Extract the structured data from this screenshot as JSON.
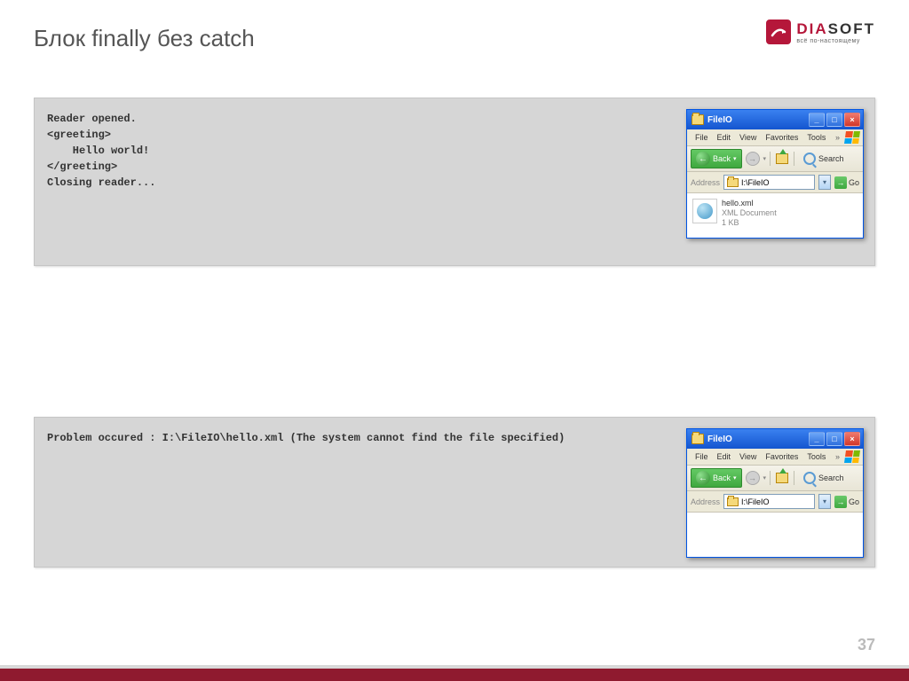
{
  "slide": {
    "title": "Блок finally без catch",
    "pageNumber": "37"
  },
  "logo": {
    "brand_dia": "DIA",
    "brand_soft": "SOFT",
    "tagline": "всё по-настоящему"
  },
  "panel1": {
    "code": "Reader opened.\n<greeting>\n    Hello world!\n</greeting>\nClosing reader..."
  },
  "panel2": {
    "code": "Problem occured : I:\\FileIO\\hello.xml (The system cannot find the file specified)"
  },
  "explorer1": {
    "title": "FileIO",
    "menu": {
      "file": "File",
      "edit": "Edit",
      "view": "View",
      "favorites": "Favorites",
      "tools": "Tools"
    },
    "toolbar": {
      "back": "Back",
      "search": "Search"
    },
    "address": {
      "label": "Address",
      "path": "I:\\FileIO",
      "go": "Go"
    },
    "file": {
      "name": "hello.xml",
      "type": "XML Document",
      "size": "1 KB"
    }
  },
  "explorer2": {
    "title": "FileIO",
    "menu": {
      "file": "File",
      "edit": "Edit",
      "view": "View",
      "favorites": "Favorites",
      "tools": "Tools"
    },
    "toolbar": {
      "back": "Back",
      "search": "Search"
    },
    "address": {
      "label": "Address",
      "path": "I:\\FileIO",
      "go": "Go"
    }
  }
}
